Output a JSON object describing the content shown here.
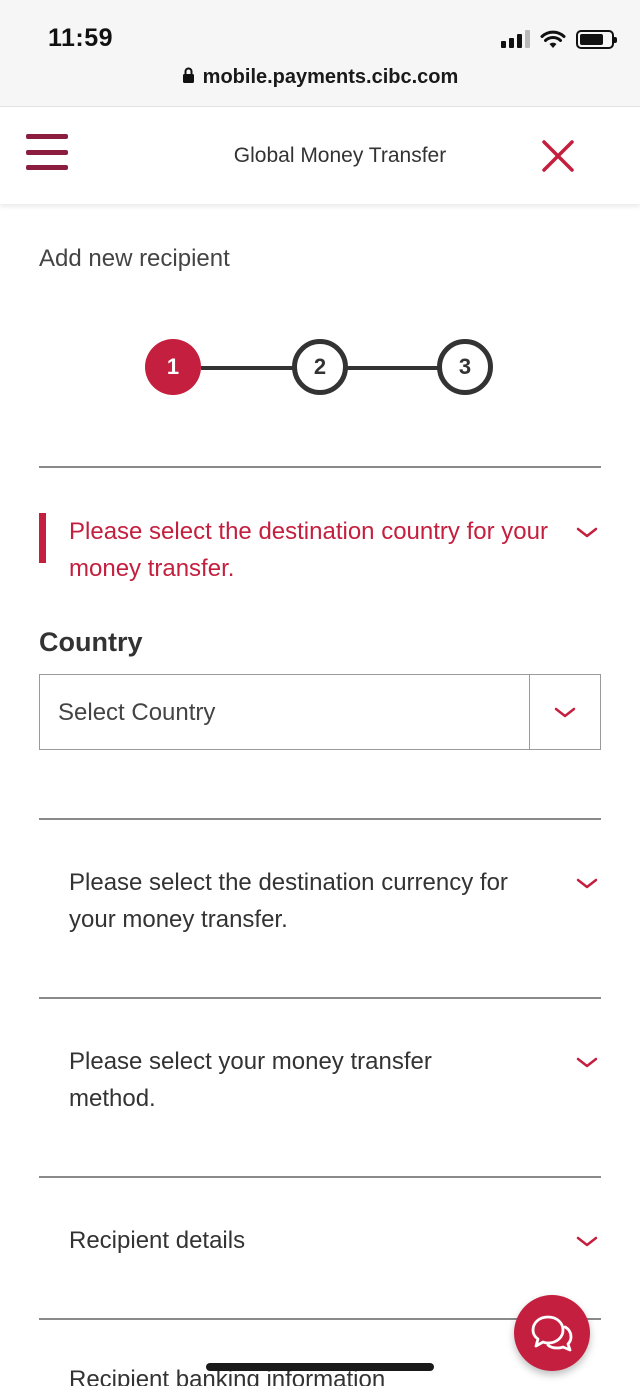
{
  "status_bar": {
    "time": "11:59",
    "icons": [
      "cellular-signal-icon",
      "wifi-icon",
      "battery-icon"
    ]
  },
  "browser": {
    "url": "mobile.payments.cibc.com",
    "lock_icon": "lock-icon"
  },
  "header": {
    "title": "Global Money Transfer",
    "menu_icon": "hamburger-menu-icon",
    "close_icon": "close-icon"
  },
  "page": {
    "subtitle": "Add new recipient",
    "steps": [
      "1",
      "2",
      "3"
    ],
    "current_step": "1"
  },
  "sections": [
    {
      "label": "Please select the destination country for your money transfer.",
      "state": "expanded"
    },
    {
      "label": "Please select the destination currency for your money transfer.",
      "state": "collapsed"
    },
    {
      "label": "Please select your money transfer method.",
      "state": "collapsed"
    },
    {
      "label": "Recipient details",
      "state": "collapsed"
    },
    {
      "label": "Recipient banking information",
      "state": "collapsed"
    }
  ],
  "country_field": {
    "label": "Country",
    "value": "Select Country"
  },
  "chat": {
    "icon": "chat-bubbles-icon"
  },
  "colors": {
    "brand_red": "#c41f3e",
    "menu_maroon": "#8b1e3f",
    "text_dark": "#333333"
  }
}
